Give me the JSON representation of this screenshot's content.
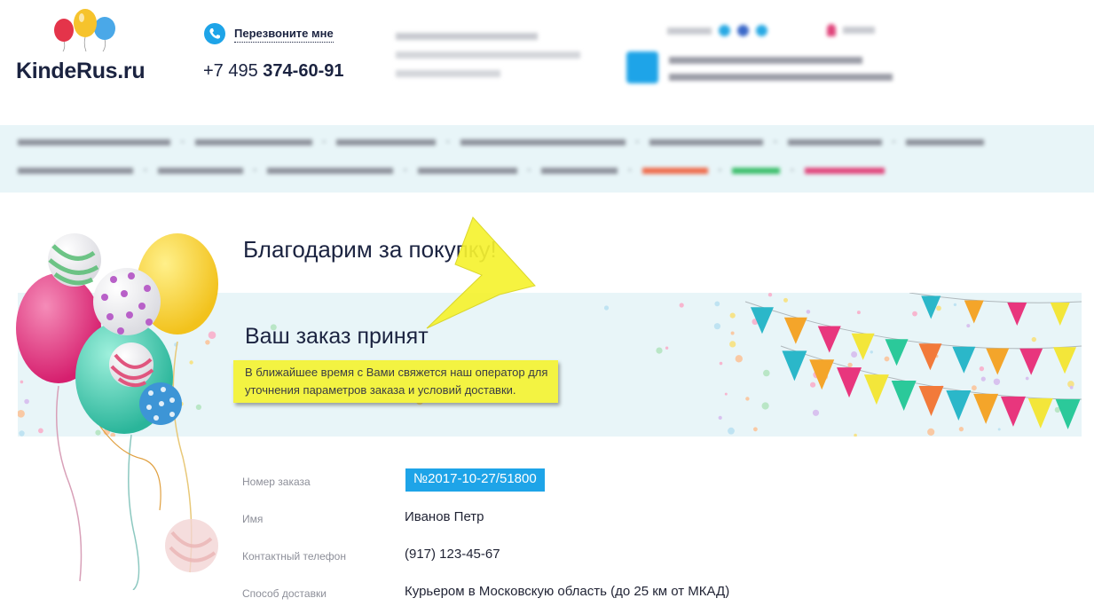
{
  "header": {
    "logo_text": "KindeRus.ru",
    "callback_label": "Перезвоните мне",
    "phone_prefix": "+7 495 ",
    "phone_main": "374-60-91"
  },
  "thanks_title": "Благодарим за покупку!",
  "order_status": {
    "title": "Ваш заказ принят",
    "note_line1": "В ближайшее время с Вами свяжется наш оператор для",
    "note_line2": "уточнения параметров заказа и условий доставки."
  },
  "order_details": [
    {
      "label": "Номер заказа",
      "value": "№2017-10-27/51800"
    },
    {
      "label": "Имя",
      "value": "Иванов Петр"
    },
    {
      "label": "Контактный телефон",
      "value": "(917) 123-45-67"
    },
    {
      "label": "Способ доставки",
      "value": "Курьером в Московскую область (до 25 км от МКАД)"
    }
  ],
  "colors": {
    "accent_blue": "#1ea4e8",
    "band_bg": "#e8f5f8",
    "note_yellow": "#f3f342",
    "dark_text": "#1b2340"
  }
}
